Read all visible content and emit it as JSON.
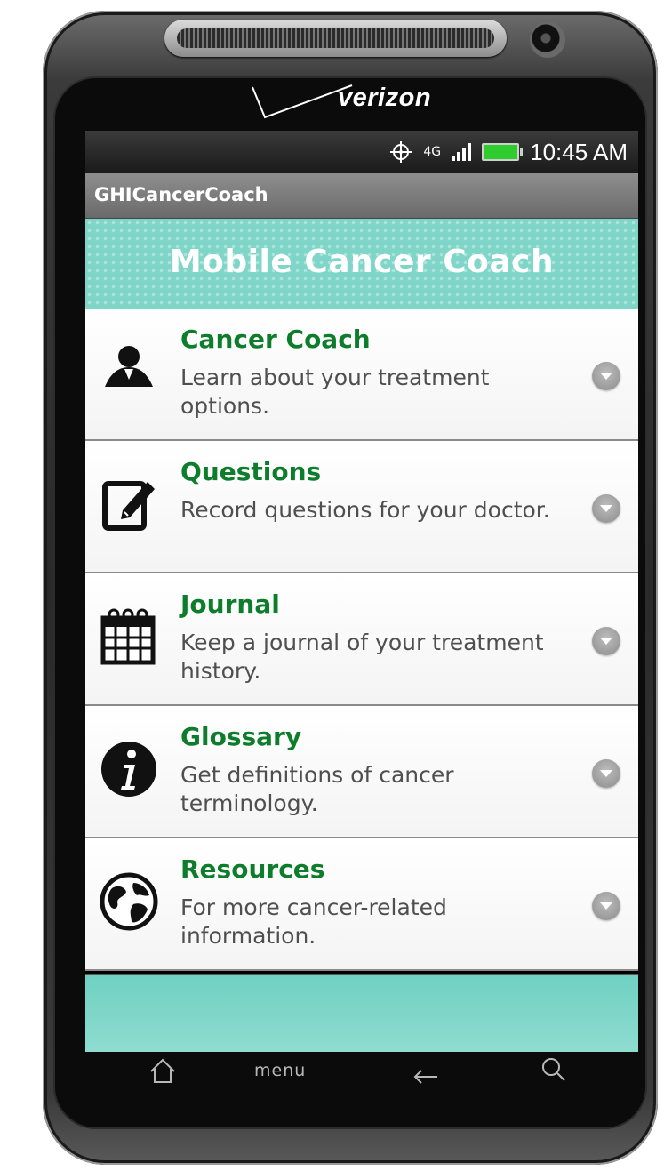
{
  "device": {
    "carrier": "verizon"
  },
  "status_bar": {
    "time": "10:45 AM",
    "network": "4G",
    "icons": [
      "gps-icon",
      "4g-icon",
      "signal-icon",
      "battery-icon"
    ]
  },
  "app": {
    "title": "GHICancerCoach",
    "header": "Mobile Cancer Coach"
  },
  "menu": {
    "items": [
      {
        "label": "Cancer Coach",
        "description": "Learn about your treatment options.",
        "icon": "person-icon"
      },
      {
        "label": "Questions",
        "description": "Record questions for your doctor.",
        "icon": "edit-note-icon"
      },
      {
        "label": "Journal",
        "description": "Keep a journal of your treatment history.",
        "icon": "calendar-icon"
      },
      {
        "label": "Glossary",
        "description": "Get definitions of cancer terminology.",
        "icon": "info-icon"
      },
      {
        "label": "Resources",
        "description": "For more cancer-related information.",
        "icon": "globe-icon"
      }
    ]
  },
  "nav": {
    "menu_label": "menu",
    "icons": [
      "home-icon",
      "menu-button",
      "back-icon",
      "search-icon"
    ]
  },
  "colors": {
    "accent_green": "#0d7d2c",
    "teal_band": "#7fd6c8",
    "title_bar": "#7a7a7a"
  }
}
